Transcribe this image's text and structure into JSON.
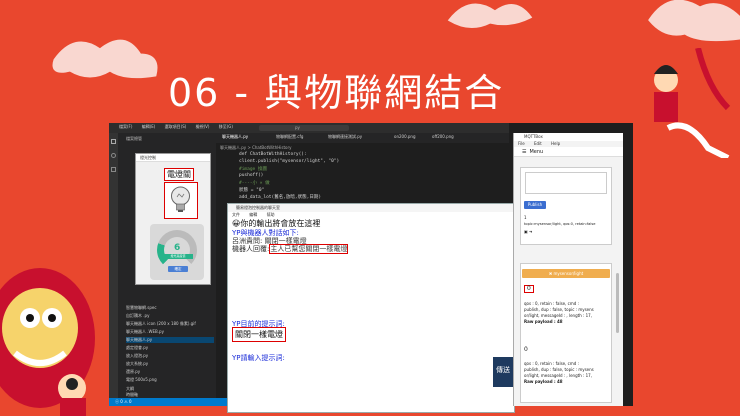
{
  "slide": {
    "title": "06 - 與物聯網結合"
  },
  "vscode": {
    "menu": [
      "檔案(F)",
      "編輯(E)",
      "選取項目(S)",
      "檢視(V)",
      "移至(G)"
    ],
    "search": "py",
    "sidebar_header": "檔案總管",
    "files": [
      "智慧物聯網.spec",
      "自訂積木 .py",
      "聊天機器人 icon (200 x 180 像素).gif",
      "聊天機器人 .WEB.py",
      "聊天機器人.py",
      "處定燈會.py",
      "放入燈泡.py",
      "放大系統.py",
      "還原.py",
      "電燈 500x5.png"
    ],
    "selected_file": "聊天機器人.py",
    "tabs": [
      "聊天機器人.py",
      "物聯網配置.cfg",
      "物聯網連接測試.py",
      "on200.png",
      "off200.png"
    ],
    "breadcrumb": "聊天機器人.py > ChatBotWithHistory",
    "code_lines": [
      "def ChatBotWithHistory():",
      "    client.publish(\"mysensor/light\", \"0\")",
      "    #image 換圖",
      "    pushoff()",
      "    #----小 × 做",
      "    狀態 = \"0\"",
      "    add_data_lot(舊名,放暗,狀態,日期)"
    ],
    "sidebar_footer": [
      "大綱",
      "時間軸"
    ],
    "status": "ⓧ 0 ⚠ 0"
  },
  "bulb_window": {
    "title": "燈光控制",
    "label": "電燈關",
    "gauge_value": "6",
    "gauge_fill_percent": 24,
    "gauge_label": "燈光亮度值",
    "button": "確定"
  },
  "chat_window": {
    "title": "簡易燈泡控制器的聊天室",
    "menu": [
      "文件",
      "編輯",
      "幫助"
    ],
    "output_header": "😀你的輸出將會放在這裡",
    "section1": "YP與機器人對話如下:",
    "line1": "呂洲貴問: 關閉一樣電燈",
    "line2_prefix": "機器人回覆:",
    "line2_highlight": "主人已幫您關閉一樣電燈",
    "section2": "YP目前的提示詞:",
    "prompt_value": "關閉一樣電燈",
    "section3": "YP請輸入提示詞:",
    "send_button": "傳送"
  },
  "mqttbox": {
    "title": "MQTTBox",
    "menu": [
      "File",
      "Edit",
      "Help"
    ],
    "nav_label": "Menu",
    "publish_button": "Publish",
    "msg1_index": "1",
    "msg1_text": "topic:mysensor/light, qos:0, retain:false",
    "subscribe_bar": "mysensor/light",
    "value_boxed": "0",
    "msg2_text1": "qos : 0, retain : false, cmd :",
    "msg2_text2": "publish, dup : false, topic : mysens",
    "msg2_text3": "or/light, messageId : , length : 17,",
    "msg2_text4": "Raw payload : 48",
    "value2": "0",
    "msg3_text1": "qos : 0, retain : false, cmd :",
    "msg3_text2": "publish, dup : false, topic : mysens",
    "msg3_text3": "or/light, messageId : , length : 17,",
    "msg3_text4": "Raw payload : 48"
  },
  "colors": {
    "slide_red": "#e9472e",
    "highlight_red": "#dd0000",
    "chat_blue": "#1a2bd8",
    "vs_blue": "#007acc"
  }
}
